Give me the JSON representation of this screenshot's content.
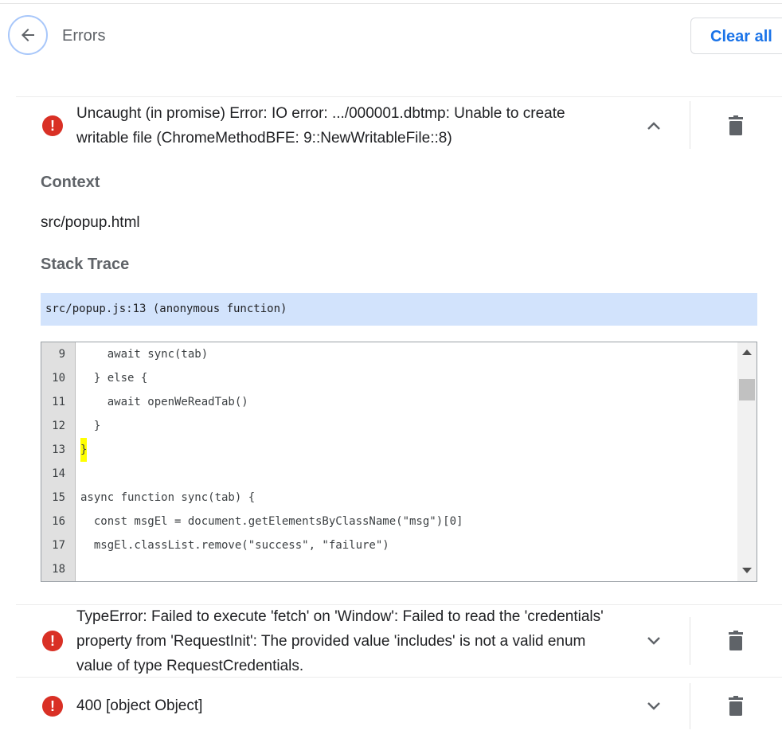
{
  "header": {
    "title": "Errors",
    "clear_label": "Clear all"
  },
  "icons": {
    "back": "arrow-left-icon",
    "error": "error-icon",
    "expand": "chevron-down-icon",
    "collapse": "chevron-up-icon",
    "delete": "trash-icon"
  },
  "colors": {
    "accent": "#1a73e8",
    "error": "#d93025",
    "stack_highlight": "#d2e3fc",
    "code_highlight": "#ffff00"
  },
  "errors": [
    {
      "message_lines": [
        "Uncaught (in promise) Error: IO error: .../000001.dbtmp: Unable to create",
        "writable file (ChromeMethodBFE: 9::NewWritableFile::8)"
      ],
      "expanded": true
    },
    {
      "message_lines": [
        "TypeError: Failed to execute 'fetch' on 'Window': Failed to read the 'credentials'",
        "property from 'RequestInit': The provided value 'includes' is not a valid enum",
        "value of type RequestCredentials."
      ],
      "expanded": false
    },
    {
      "message_lines": [
        "400 [object Object]"
      ],
      "expanded": false
    }
  ],
  "details": {
    "context_heading": "Context",
    "context_value": "src/popup.html",
    "stack_heading": "Stack Trace",
    "stack_frame": "src/popup.js:13 (anonymous function)"
  },
  "code": {
    "lines": [
      {
        "num": "9",
        "text": "    await sync(tab)"
      },
      {
        "num": "10",
        "text": "  } else {"
      },
      {
        "num": "11",
        "text": "    await openWeReadTab()"
      },
      {
        "num": "12",
        "text": "  }"
      },
      {
        "num": "13",
        "text": "}"
      },
      {
        "num": "14",
        "text": ""
      },
      {
        "num": "15",
        "text": "async function sync(tab) {"
      },
      {
        "num": "16",
        "text": "  const msgEl = document.getElementsByClassName(\"msg\")[0]"
      },
      {
        "num": "17",
        "text": "  msgEl.classList.remove(\"success\", \"failure\")"
      },
      {
        "num": "18",
        "text": ""
      }
    ]
  }
}
